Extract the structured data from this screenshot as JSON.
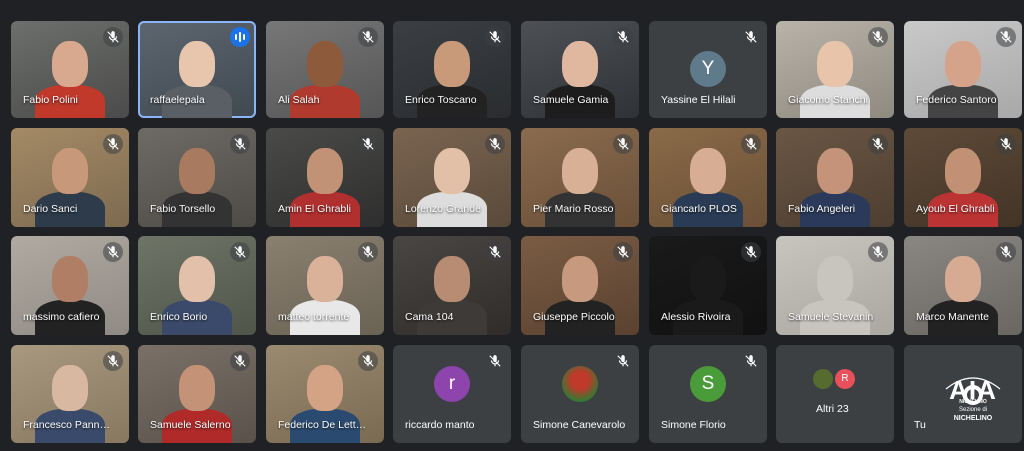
{
  "participants": [
    {
      "name": "Fabio Polini"
    },
    {
      "name": "raffaelepala"
    },
    {
      "name": "Ali Salah"
    },
    {
      "name": "Enrico Toscano"
    },
    {
      "name": "Samuele Gamia"
    },
    {
      "name": "Yassine El Hilali",
      "initial": "Y"
    },
    {
      "name": "Giacomo Stanchi"
    },
    {
      "name": "Federico Santoro"
    },
    {
      "name": "Dario Sanci"
    },
    {
      "name": "Fabio Torsello"
    },
    {
      "name": "Amin El Ghrabli"
    },
    {
      "name": "Lorenzo Grande"
    },
    {
      "name": "Pier Mario Rosso"
    },
    {
      "name": "Giancarlo PLOS"
    },
    {
      "name": "Fabio Angeleri"
    },
    {
      "name": "Ayoub El Ghrabli"
    },
    {
      "name": "massimo cafiero"
    },
    {
      "name": "Enrico Borio"
    },
    {
      "name": "matteo torrente"
    },
    {
      "name": "Cama 104"
    },
    {
      "name": "Giuseppe Piccolo"
    },
    {
      "name": "Alessio Rivoira"
    },
    {
      "name": "Samuele Stevanin"
    },
    {
      "name": "Marco Manente"
    },
    {
      "name": "Francesco Pann…"
    },
    {
      "name": "Samuele Salerno"
    },
    {
      "name": "Federico De Lett…"
    },
    {
      "name": "riccardo manto",
      "initial": "r"
    },
    {
      "name": "Simone Canevarolo"
    },
    {
      "name": "Simone Florio",
      "initial": "S"
    },
    {
      "name": "Altri 23",
      "initial": "R"
    },
    {
      "name": "Tu"
    }
  ],
  "logo": {
    "text": "AIA",
    "sub1": "Sezione di",
    "sub2": "NICHELINO",
    "arc": "NICHELINO"
  },
  "colors": {
    "background": "#202124",
    "tile": "#3c4043",
    "speaking": "#1a73e8",
    "avatar_Y": "#5f7a8a",
    "avatar_r": "#8e44ad",
    "avatar_S": "#4a9c3a",
    "avatar_R": "#e8505b"
  }
}
